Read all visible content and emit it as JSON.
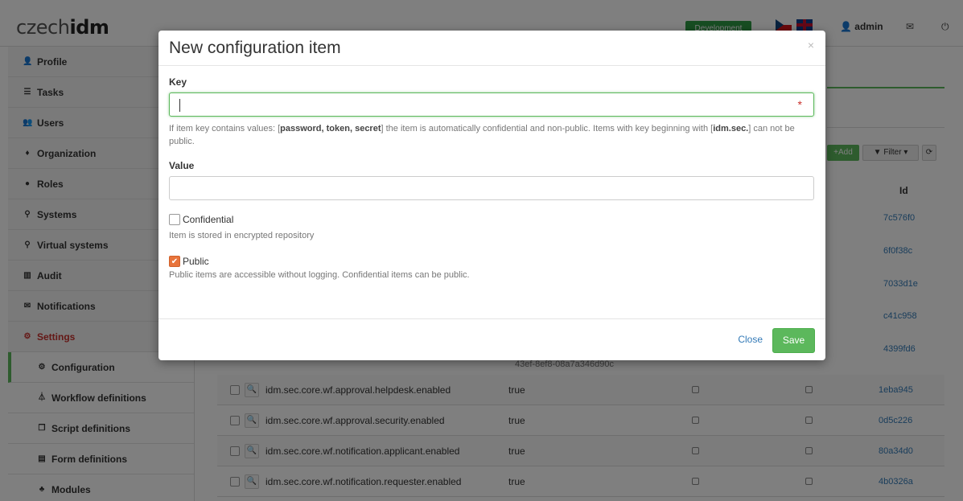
{
  "app": {
    "logo_prefix": "czech",
    "logo_suffix": "idm",
    "environment": "Development",
    "user": "admin",
    "user_icon": "user-icon",
    "mail_icon": "envelope-icon",
    "logout_icon": "power-icon"
  },
  "sidebar": {
    "items": [
      {
        "label": "Profile",
        "icon": "user-icon",
        "glyph": "👤"
      },
      {
        "label": "Tasks",
        "icon": "list-icon",
        "glyph": "☰"
      },
      {
        "label": "Users",
        "icon": "users-icon",
        "glyph": "👥"
      },
      {
        "label": "Organization",
        "icon": "tree-icon",
        "glyph": "♦"
      },
      {
        "label": "Roles",
        "icon": "roles-icon",
        "glyph": "●"
      },
      {
        "label": "Systems",
        "icon": "link-icon",
        "glyph": "⚲"
      },
      {
        "label": "Virtual systems",
        "icon": "link-icon",
        "glyph": "⚲"
      },
      {
        "label": "Audit",
        "icon": "chart-icon",
        "glyph": "▥"
      },
      {
        "label": "Notifications",
        "icon": "envelope-icon",
        "glyph": "✉"
      },
      {
        "label": "Settings",
        "icon": "settings-icon",
        "glyph": "⚙"
      }
    ],
    "sub_items": [
      {
        "label": "Configuration",
        "icon": "gear-icon",
        "glyph": "⚙"
      },
      {
        "label": "Workflow definitions",
        "icon": "workflow-icon",
        "glyph": "⏃"
      },
      {
        "label": "Script definitions",
        "icon": "script-icon",
        "glyph": "❐"
      },
      {
        "label": "Form definitions",
        "icon": "form-icon",
        "glyph": "▤"
      },
      {
        "label": "Modules",
        "icon": "modules-icon",
        "glyph": "♣"
      }
    ]
  },
  "toolbar": {
    "add_label": "Add",
    "filter_label": "Filter",
    "refresh_icon": "refresh-icon"
  },
  "table": {
    "id_header": "Id",
    "visible_ids": [
      "7c576f0",
      "6f0f38c",
      "7033d1e",
      "c41c958",
      "4399fd6"
    ],
    "partial_value": "43ef-8ef8-08a7a346d90c",
    "rows": [
      {
        "key": "idm.sec.core.wf.approval.helpdesk.enabled",
        "value": "true",
        "id": "1eba945"
      },
      {
        "key": "idm.sec.core.wf.approval.security.enabled",
        "value": "true",
        "id": "0d5c226"
      },
      {
        "key": "idm.sec.core.wf.notification.applicant.enabled",
        "value": "true",
        "id": "80a34d0"
      },
      {
        "key": "idm.sec.core.wf.notification.requester.enabled",
        "value": "true",
        "id": "4b0326a"
      }
    ]
  },
  "modal": {
    "title": "New configuration item",
    "close_icon": "close-icon",
    "key_label": "Key",
    "key_value": "",
    "key_help_1": "If item key contains values: [",
    "key_help_bold_1": "password, token, secret",
    "key_help_2": "] the item is automatically confidential and non-public. Items with key beginning with [",
    "key_help_bold_2": "idm.sec.",
    "key_help_3": "] can not be public.",
    "value_label": "Value",
    "value_value": "",
    "confidential_label": "Confidential",
    "confidential_checked": false,
    "confidential_help": "Item is stored in encrypted repository",
    "public_label": "Public",
    "public_checked": true,
    "public_help": "Public items are accessible without logging. Confidential items can be public.",
    "close_button": "Close",
    "save_button": "Save"
  }
}
